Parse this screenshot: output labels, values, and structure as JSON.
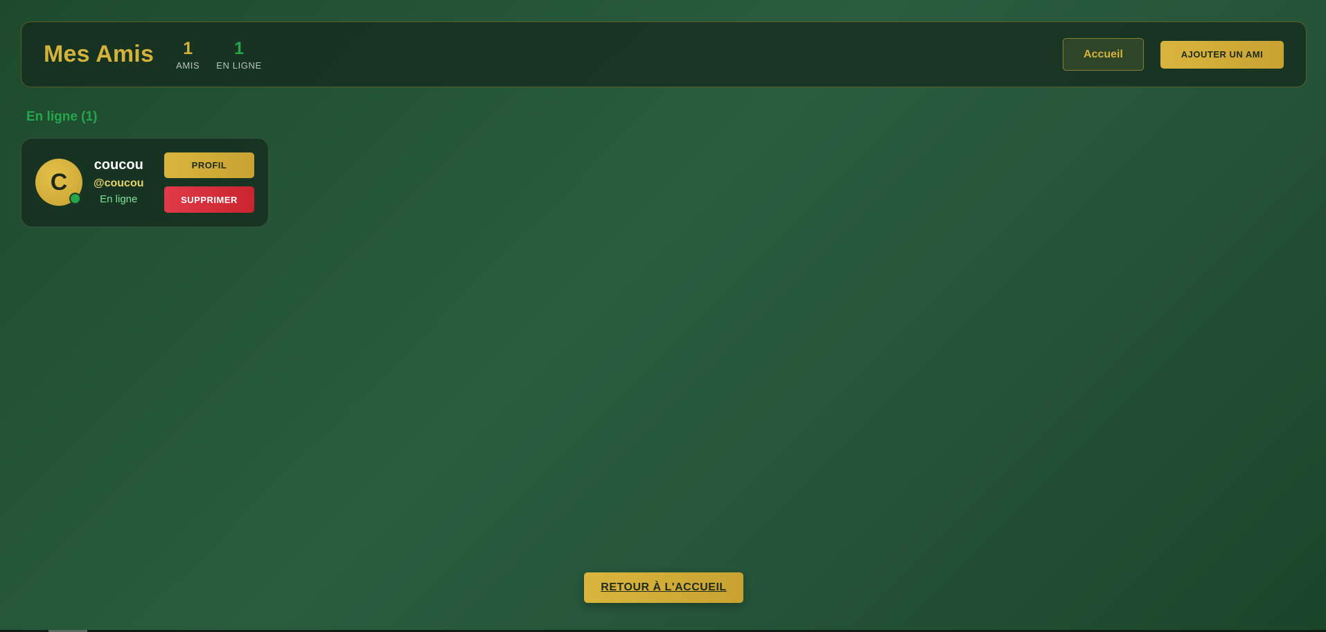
{
  "header": {
    "title": "Mes Amis",
    "stats": [
      {
        "value": "1",
        "label": "AMIS"
      },
      {
        "value": "1",
        "label": "EN LIGNE"
      }
    ],
    "home_label": "Accueil",
    "add_friend_label": "AJOUTER UN AMI"
  },
  "online_section": {
    "title": "En ligne (1)",
    "friends": [
      {
        "initial": "C",
        "name": "coucou",
        "handle": "@coucou",
        "status": "En ligne",
        "profile_label": "PROFIL",
        "delete_label": "SUPPRIMER"
      }
    ]
  },
  "footer": {
    "back_label": "RETOUR À L'ACCUEIL"
  },
  "colors": {
    "gold": "#d4b23c",
    "online_green": "#26a64a",
    "danger_red": "#d9303c",
    "background": "#2b5c3e"
  }
}
